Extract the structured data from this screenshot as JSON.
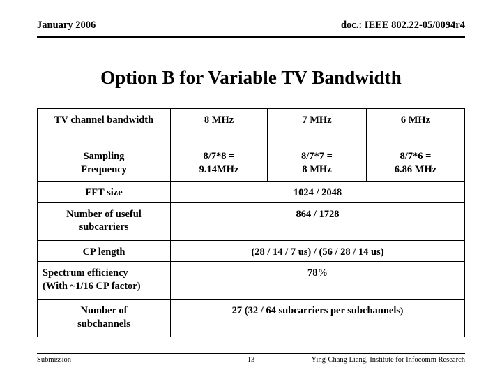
{
  "header": {
    "date": "January 2006",
    "doc": "doc.: IEEE 802.22-05/0094r4"
  },
  "title": "Option B for Variable TV Bandwidth",
  "table": {
    "columns": [
      "TV channel bandwidth",
      "8 MHz",
      "7 MHz",
      "6 MHz"
    ],
    "rows": [
      {
        "label": "Sampling\nFrequency",
        "label_line1": "Sampling",
        "label_line2": "Frequency",
        "values": [
          "8/7*8 =\n9.14MHz",
          "8/7*7 =\n8 MHz",
          "8/7*6 =\n6.86 MHz"
        ],
        "v1_line1": "8/7*8 =",
        "v1_line2": "9.14MHz",
        "v2_line1": "8/7*7 =",
        "v2_line2": "8 MHz",
        "v3_line1": "8/7*6 =",
        "v3_line2": "6.86 MHz"
      },
      {
        "label": "FFT size",
        "merged_value": "1024 / 2048"
      },
      {
        "label_line1": "Number of useful",
        "label_line2": "subcarriers",
        "merged_value": "864 / 1728"
      },
      {
        "label": "CP length",
        "merged_value": "(28 / 14 / 7 us) / (56 / 28 / 14 us)"
      },
      {
        "label_line1": "Spectrum efficiency",
        "label_line2": "(With ~1/16 CP factor)",
        "merged_value": "78%"
      },
      {
        "label_line1": "Number of",
        "label_line2": "subchannels",
        "merged_value_main": "27 (32 / 64 subcarriers per subchannels",
        "merged_value_tail": ")"
      }
    ]
  },
  "footer": {
    "left": "Submission",
    "page": "13",
    "right": "Ying-Chang Liang, Institute for Infocomm Research"
  }
}
